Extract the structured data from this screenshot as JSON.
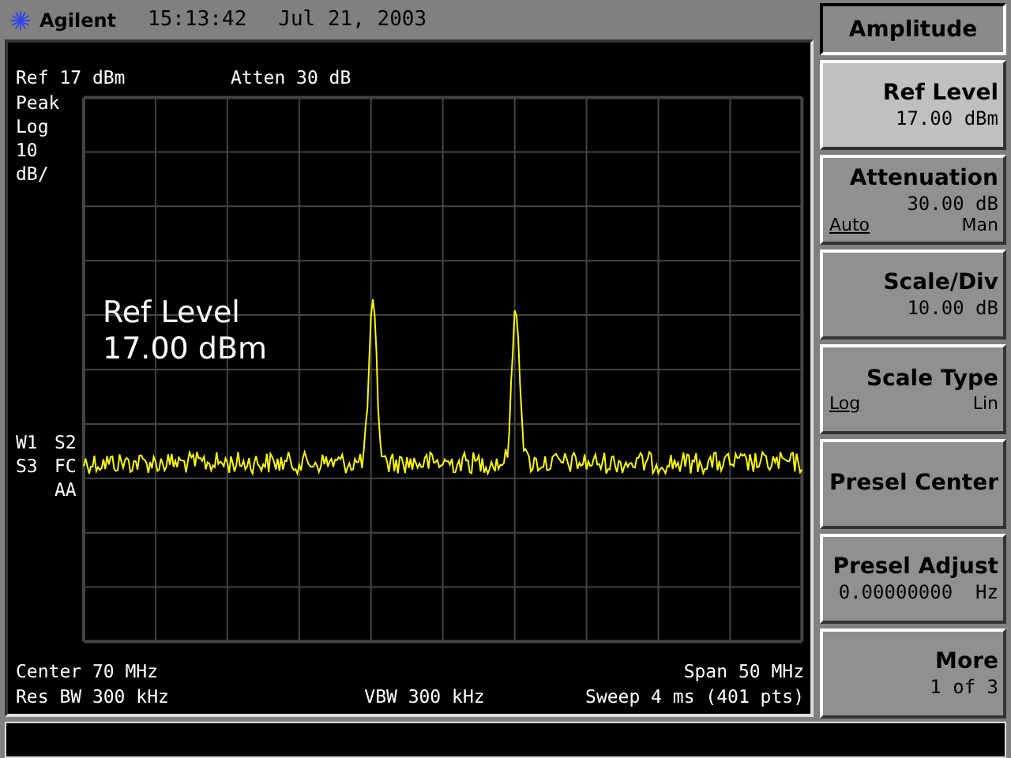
{
  "header": {
    "brand": "Agilent",
    "time": "15:13:42",
    "date": "Jul 21, 2003"
  },
  "screen": {
    "ref": "Ref 17 dBm",
    "atten": "Atten 30 dB",
    "scale_labels": [
      "Peak",
      "Log",
      "10",
      "dB/"
    ],
    "trace_labels": [
      {
        "left": "W1",
        "right": "S2"
      },
      {
        "left": "S3",
        "right": "FC"
      },
      {
        "right": "AA"
      }
    ],
    "active_function": [
      "Ref Level",
      "17.00 dBm"
    ],
    "footer": {
      "center": "Center 70 MHz",
      "span": "Span 50 MHz",
      "res_bw": "Res BW 300 kHz",
      "vbw": "VBW 300 kHz",
      "sweep": "Sweep 4 ms (401 pts)"
    }
  },
  "softkeys": {
    "title": "Amplitude",
    "keys": [
      {
        "kind": "value",
        "label": "Ref Level",
        "value": "17.00 dBm",
        "selected": true
      },
      {
        "kind": "toggle",
        "label": "Attenuation",
        "value": "30.00 dB",
        "selected": false,
        "options": [
          {
            "label": "Auto",
            "selected": true
          },
          {
            "label": "Man",
            "selected": false
          }
        ]
      },
      {
        "kind": "value",
        "label": "Scale/Div",
        "value": "10.00 dB",
        "selected": false
      },
      {
        "kind": "toggle",
        "label": "Scale Type",
        "selected": false,
        "options": [
          {
            "label": "Log",
            "selected": true
          },
          {
            "label": "Lin",
            "selected": false
          }
        ]
      },
      {
        "kind": "plain",
        "label": "Presel Center",
        "selected": false
      },
      {
        "kind": "value",
        "label": "Presel Adjust",
        "value": "0.00000000  Hz",
        "selected": false
      },
      {
        "kind": "value",
        "label": "More",
        "value": "1 of 3",
        "selected": false
      }
    ]
  }
}
